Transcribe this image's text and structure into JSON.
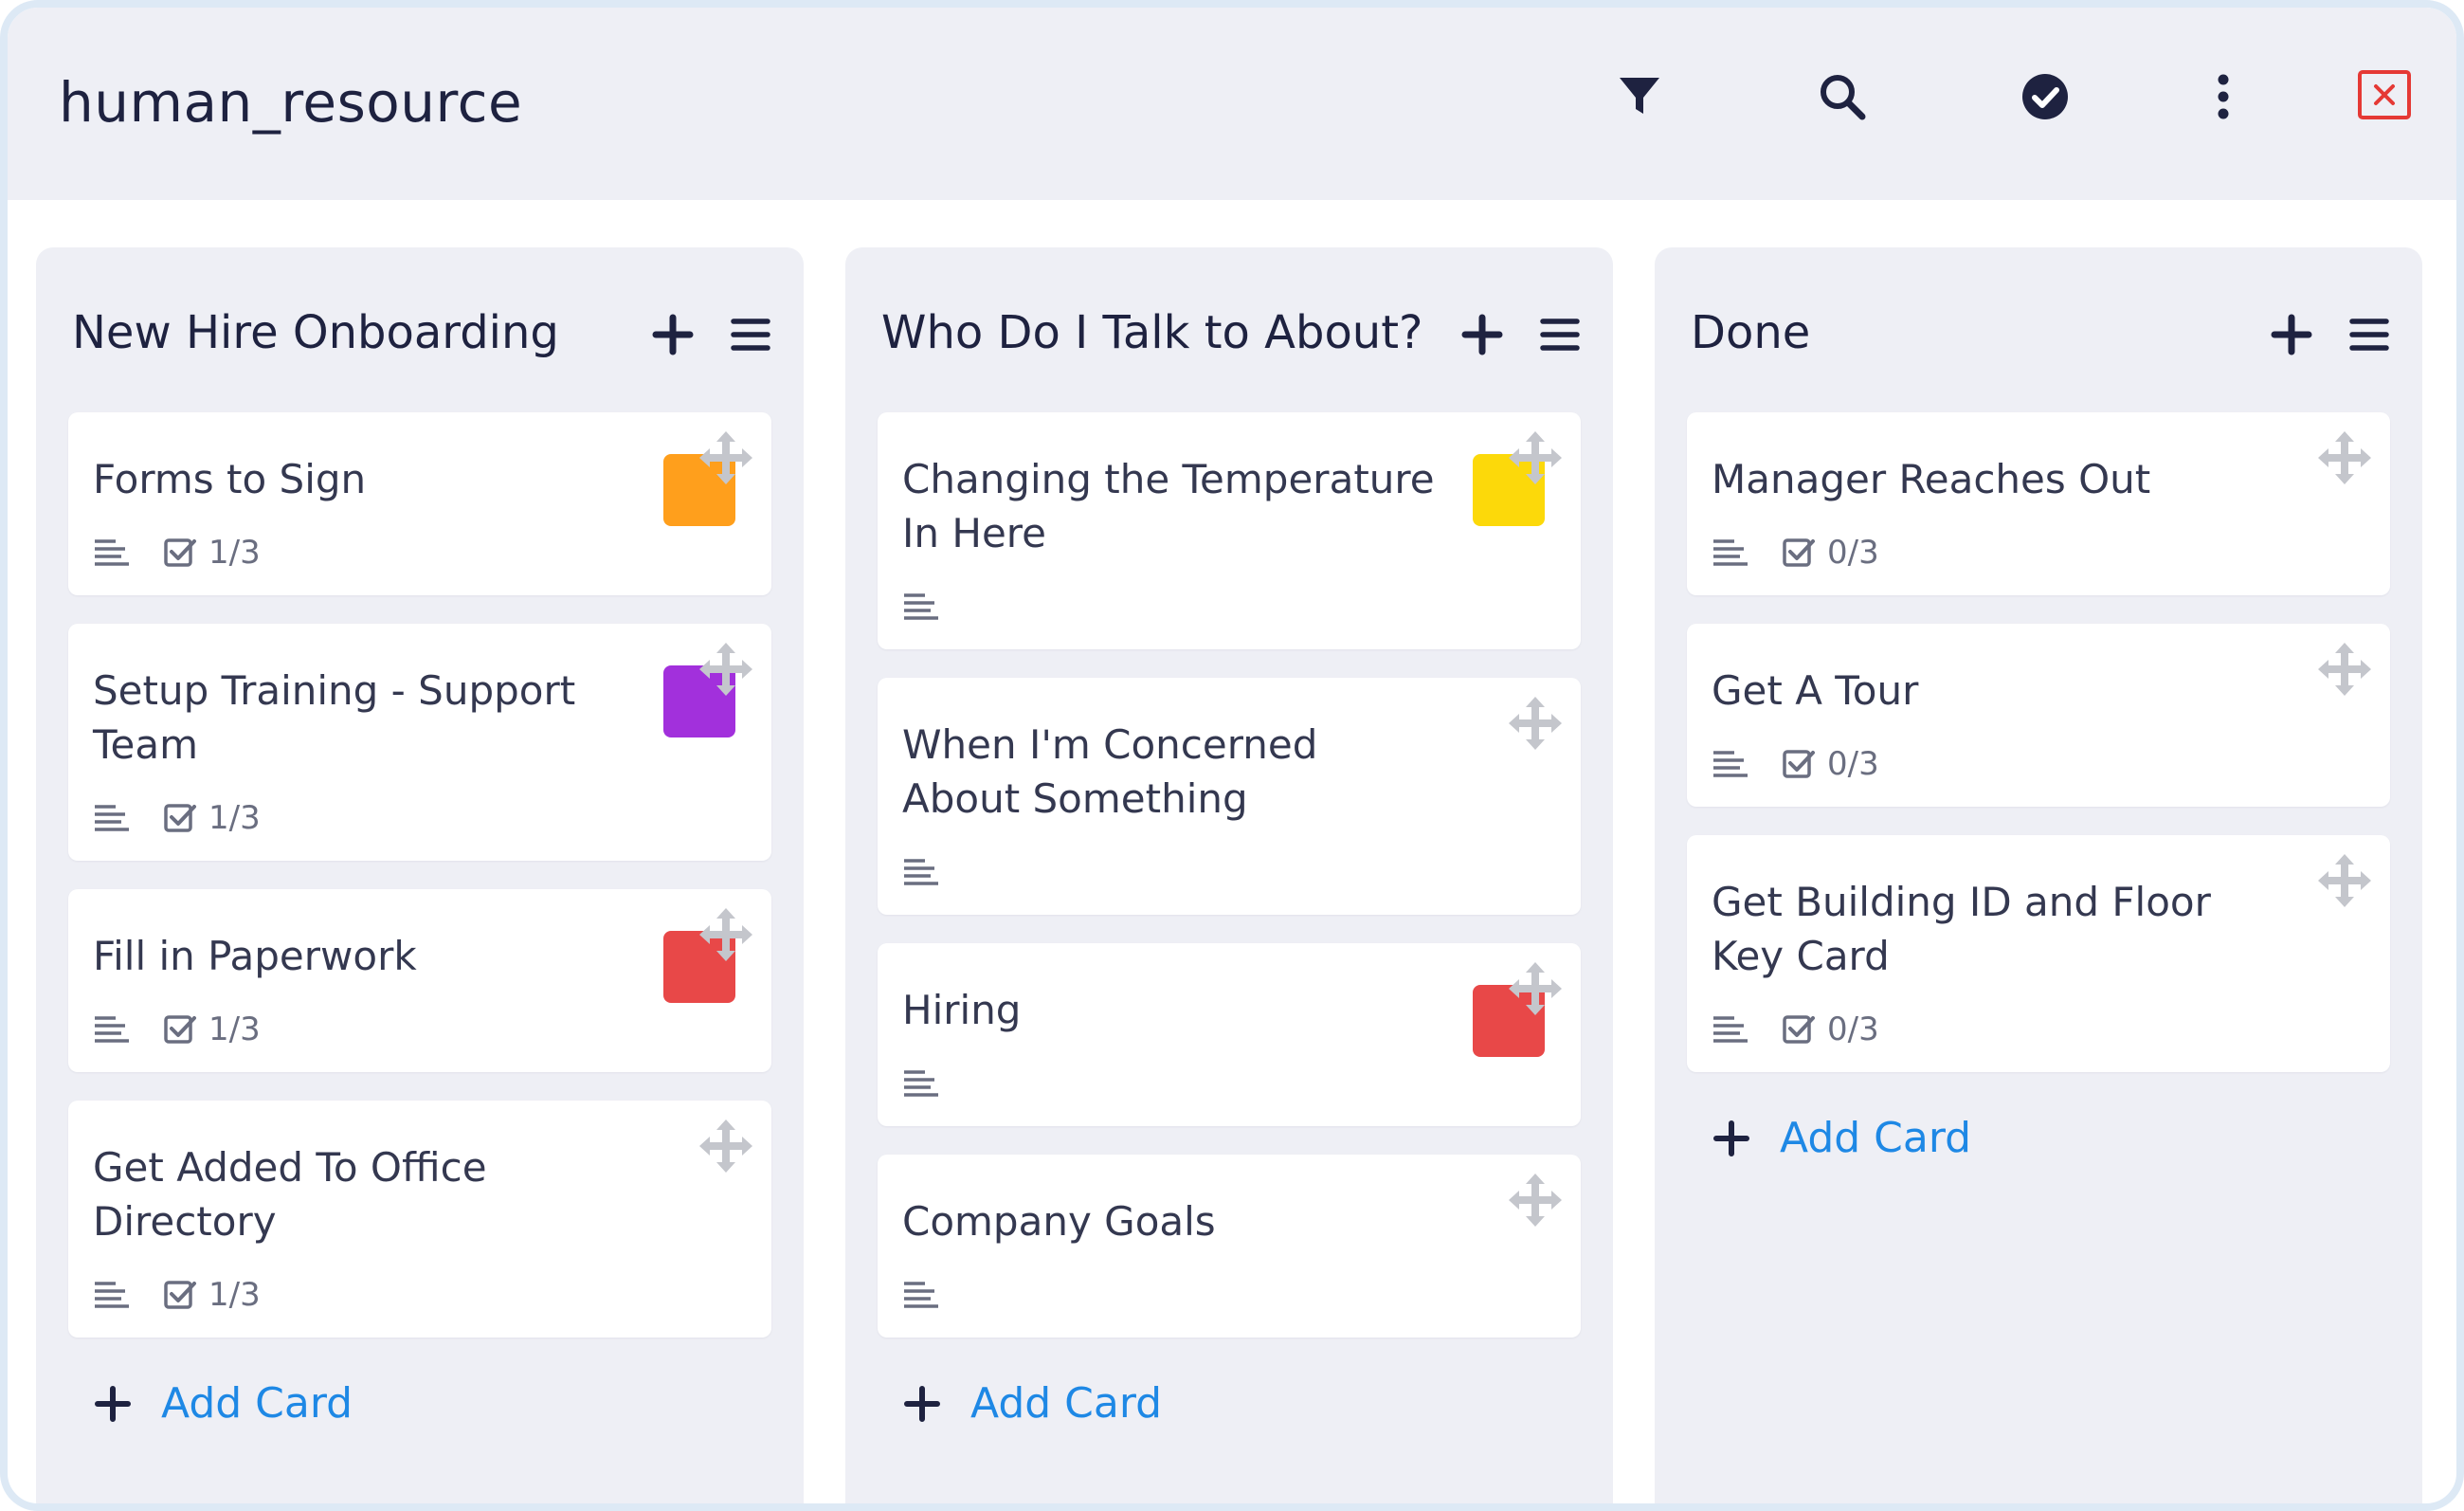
{
  "app": {
    "title": "human_resource"
  },
  "toolbar": {
    "icons": [
      "filter-icon",
      "search-icon",
      "check-circle-icon",
      "more-vertical-icon",
      "close-icon"
    ],
    "close_color": "#e53935",
    "text_color": "#1e2240"
  },
  "colors": {
    "accent": "#1e88e5",
    "column_bg": "#eeeff5",
    "card_bg": "#ffffff",
    "orange": "#ff9f1c",
    "purple": "#a230dc",
    "red": "#e84848",
    "yellow": "#fcd90a"
  },
  "columns": [
    {
      "title": "New Hire Onboarding",
      "add_card_label": "Add Card",
      "cards": [
        {
          "title": "Forms to Sign",
          "label_color": "#ff9f1c",
          "checklist": "1/3"
        },
        {
          "title": "Setup Training - Support Team",
          "label_color": "#a230dc",
          "checklist": "1/3"
        },
        {
          "title": "Fill in Paperwork",
          "label_color": "#e84848",
          "checklist": "1/3"
        },
        {
          "title": "Get Added To Office Directory",
          "label_color": null,
          "checklist": "1/3"
        }
      ]
    },
    {
      "title": "Who Do I Talk to About?",
      "add_card_label": "Add Card",
      "cards": [
        {
          "title": "Changing the Temperature In Here",
          "label_color": "#fcd90a",
          "checklist": null
        },
        {
          "title": "When I'm Concerned About Something",
          "label_color": null,
          "checklist": null
        },
        {
          "title": "Hiring",
          "label_color": "#e84848",
          "checklist": null
        },
        {
          "title": "Company Goals",
          "label_color": null,
          "checklist": null
        }
      ]
    },
    {
      "title": "Done",
      "add_card_label": "Add Card",
      "cards": [
        {
          "title": "Manager Reaches Out",
          "label_color": null,
          "checklist": "0/3"
        },
        {
          "title": "Get A Tour",
          "label_color": null,
          "checklist": "0/3"
        },
        {
          "title": "Get Building ID and Floor Key Card",
          "label_color": null,
          "checklist": "0/3"
        }
      ]
    }
  ]
}
